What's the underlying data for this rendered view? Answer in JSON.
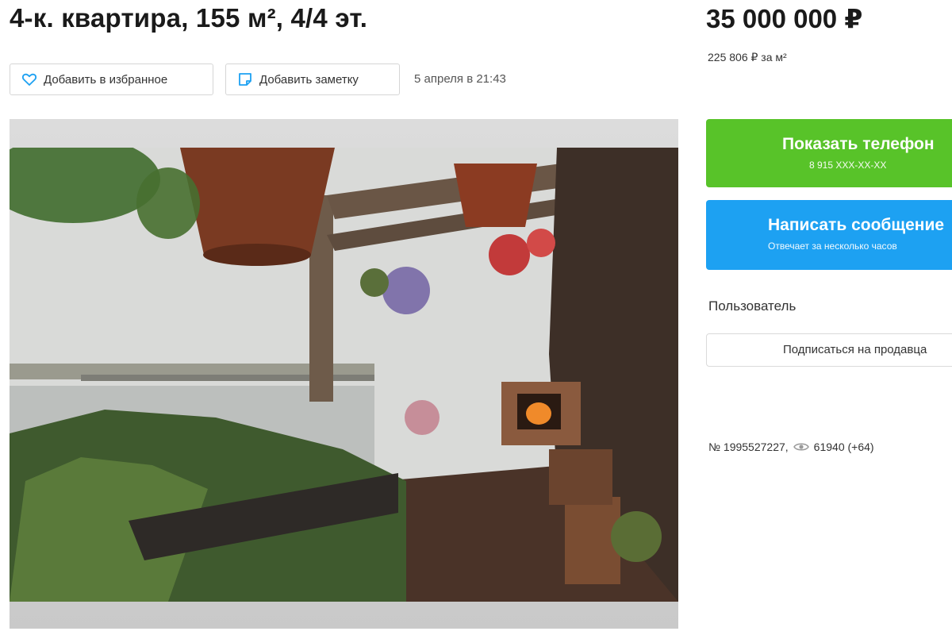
{
  "listing": {
    "title": "4-к. квартира, 155 м², 4/4 эт.",
    "price": "35 000 000 ₽",
    "price_per_m2": "225 806 ₽ за м²",
    "published": "5 апреля в 21:43",
    "number": "№ 1995527227,",
    "views": "61940 (+64)"
  },
  "actions": {
    "favorite_label": "Добавить в избранное",
    "note_label": "Добавить заметку"
  },
  "contact": {
    "phone_label": "Показать телефон",
    "phone_masked": "8 915 XXX-XX-XX",
    "message_label": "Написать сообщение",
    "message_sub": "Отвечает за несколько часов",
    "accent_green": "#58c329",
    "accent_blue": "#1da1f2"
  },
  "seller": {
    "name": "Пользователь",
    "subscribe_label": "Подписаться на продавца"
  },
  "icons": {
    "favorite": "heart-icon",
    "note": "note-icon",
    "views": "eye-icon"
  }
}
